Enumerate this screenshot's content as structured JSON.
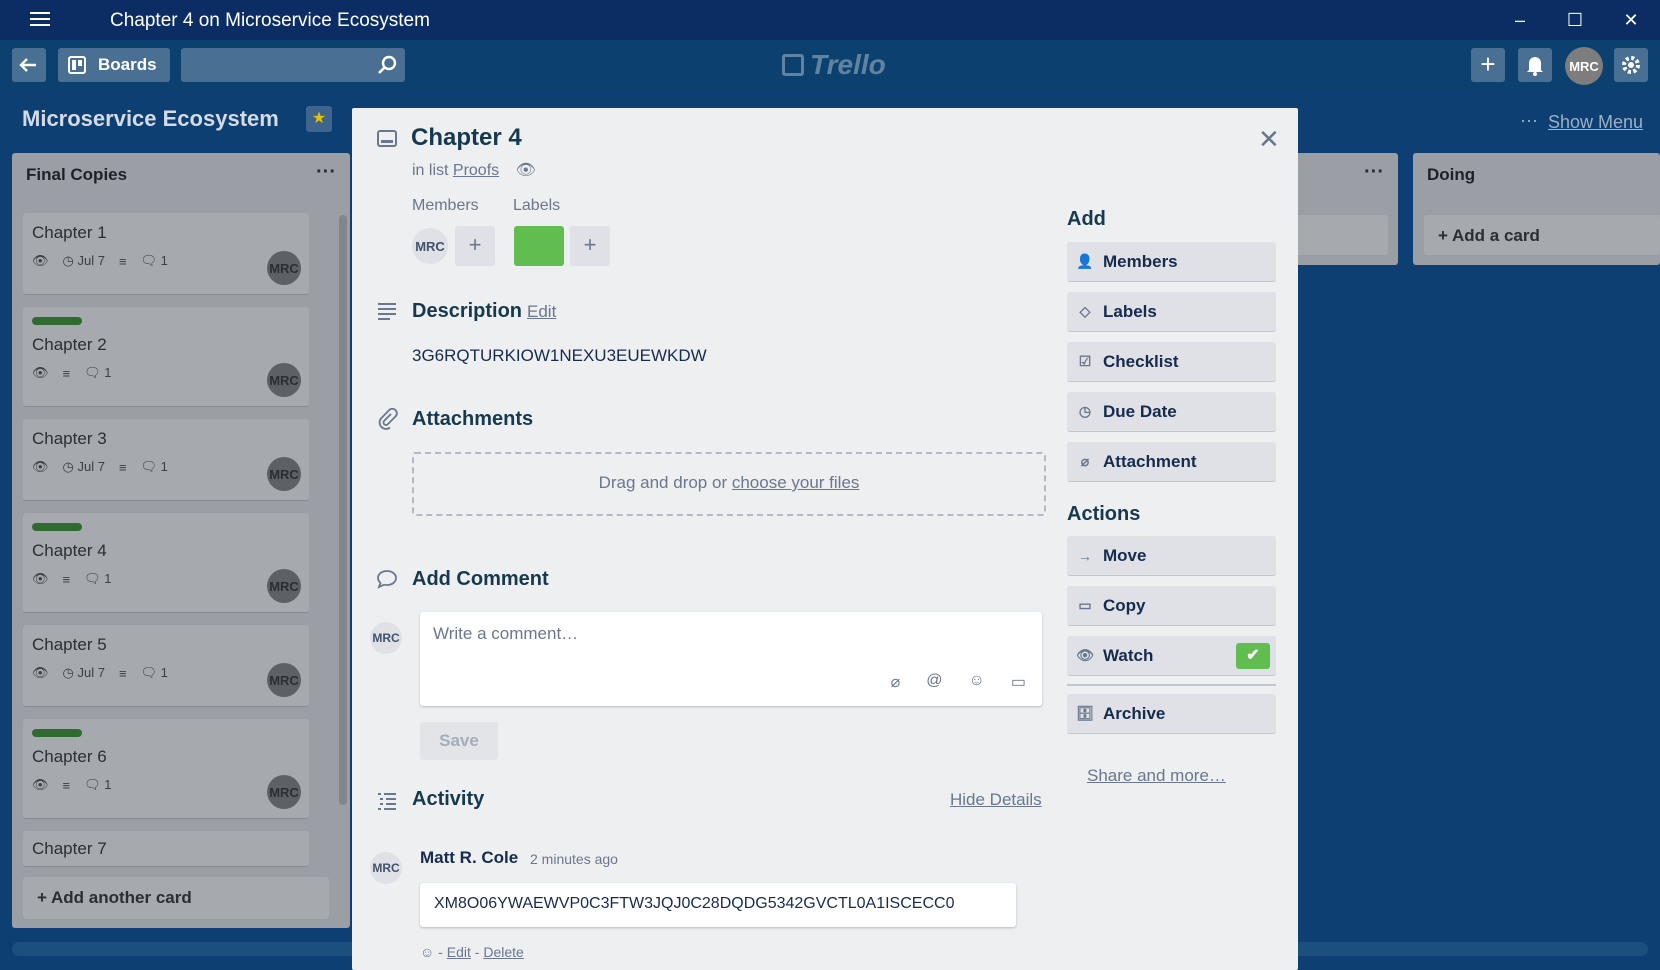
{
  "window": {
    "title": "Chapter 4 on Microservice Ecosystem",
    "minimize": "–",
    "maximize": "☐",
    "close": "✕"
  },
  "appbar": {
    "boards_label": "Boards",
    "logo_text": "Trello",
    "avatar": "MRC"
  },
  "board": {
    "title": "Microservice Ecosystem",
    "show_menu": "Show Menu",
    "menu_dots": "···"
  },
  "lists": {
    "final": {
      "title": "Final Copies",
      "cards": [
        {
          "title": "Chapter 1",
          "date": "Jul 7",
          "comments": "1",
          "avatar": "MRC"
        },
        {
          "title": "Chapter 2",
          "comments": "1",
          "avatar": "MRC"
        },
        {
          "title": "Chapter 3",
          "date": "Jul 7",
          "comments": "1",
          "avatar": "MRC"
        },
        {
          "title": "Chapter 4",
          "comments": "1",
          "avatar": "MRC"
        },
        {
          "title": "Chapter 5",
          "date": "Jul 7",
          "comments": "1",
          "avatar": "MRC"
        },
        {
          "title": "Chapter 6",
          "comments": "1",
          "avatar": "MRC"
        },
        {
          "title": "Chapter 7"
        }
      ],
      "add_card": "+ Add another card"
    },
    "doing": {
      "title": "Doing",
      "add_card": "+ Add a card"
    }
  },
  "modal": {
    "title": "Chapter 4",
    "in_list_prefix": "in list",
    "list_name": "Proofs",
    "members_label": "Members",
    "labels_label": "Labels",
    "member_avatar": "MRC",
    "label_color": "#61bd4f",
    "description_label": "Description",
    "description_edit": "Edit",
    "description_text": "3G6RQTURKIOW1NEXU3EUEWKDW",
    "attachments_label": "Attachments",
    "drop_text": "Drag and drop or",
    "drop_link": "choose your files",
    "add_comment_label": "Add Comment",
    "comment_avatar": "MRC",
    "comment_placeholder": "Write a comment…",
    "save_label": "Save",
    "activity_label": "Activity",
    "hide_details": "Hide Details",
    "activity_author": "Matt R. Cole",
    "activity_time": "2 minutes ago",
    "activity_comment": "XM8O06YWAEWVP0C3FTW3JQJ0C28DQDG5342GVCTL0A1ISCECC0",
    "activity_edit": "Edit",
    "activity_delete": "Delete",
    "activity_avatar": "MRC"
  },
  "sidebar": {
    "add_heading": "Add",
    "add_buttons": [
      "Members",
      "Labels",
      "Checklist",
      "Due Date",
      "Attachment"
    ],
    "actions_heading": "Actions",
    "action_buttons": [
      "Move",
      "Copy",
      "Watch",
      "Archive"
    ],
    "share_link": "Share and more…"
  }
}
